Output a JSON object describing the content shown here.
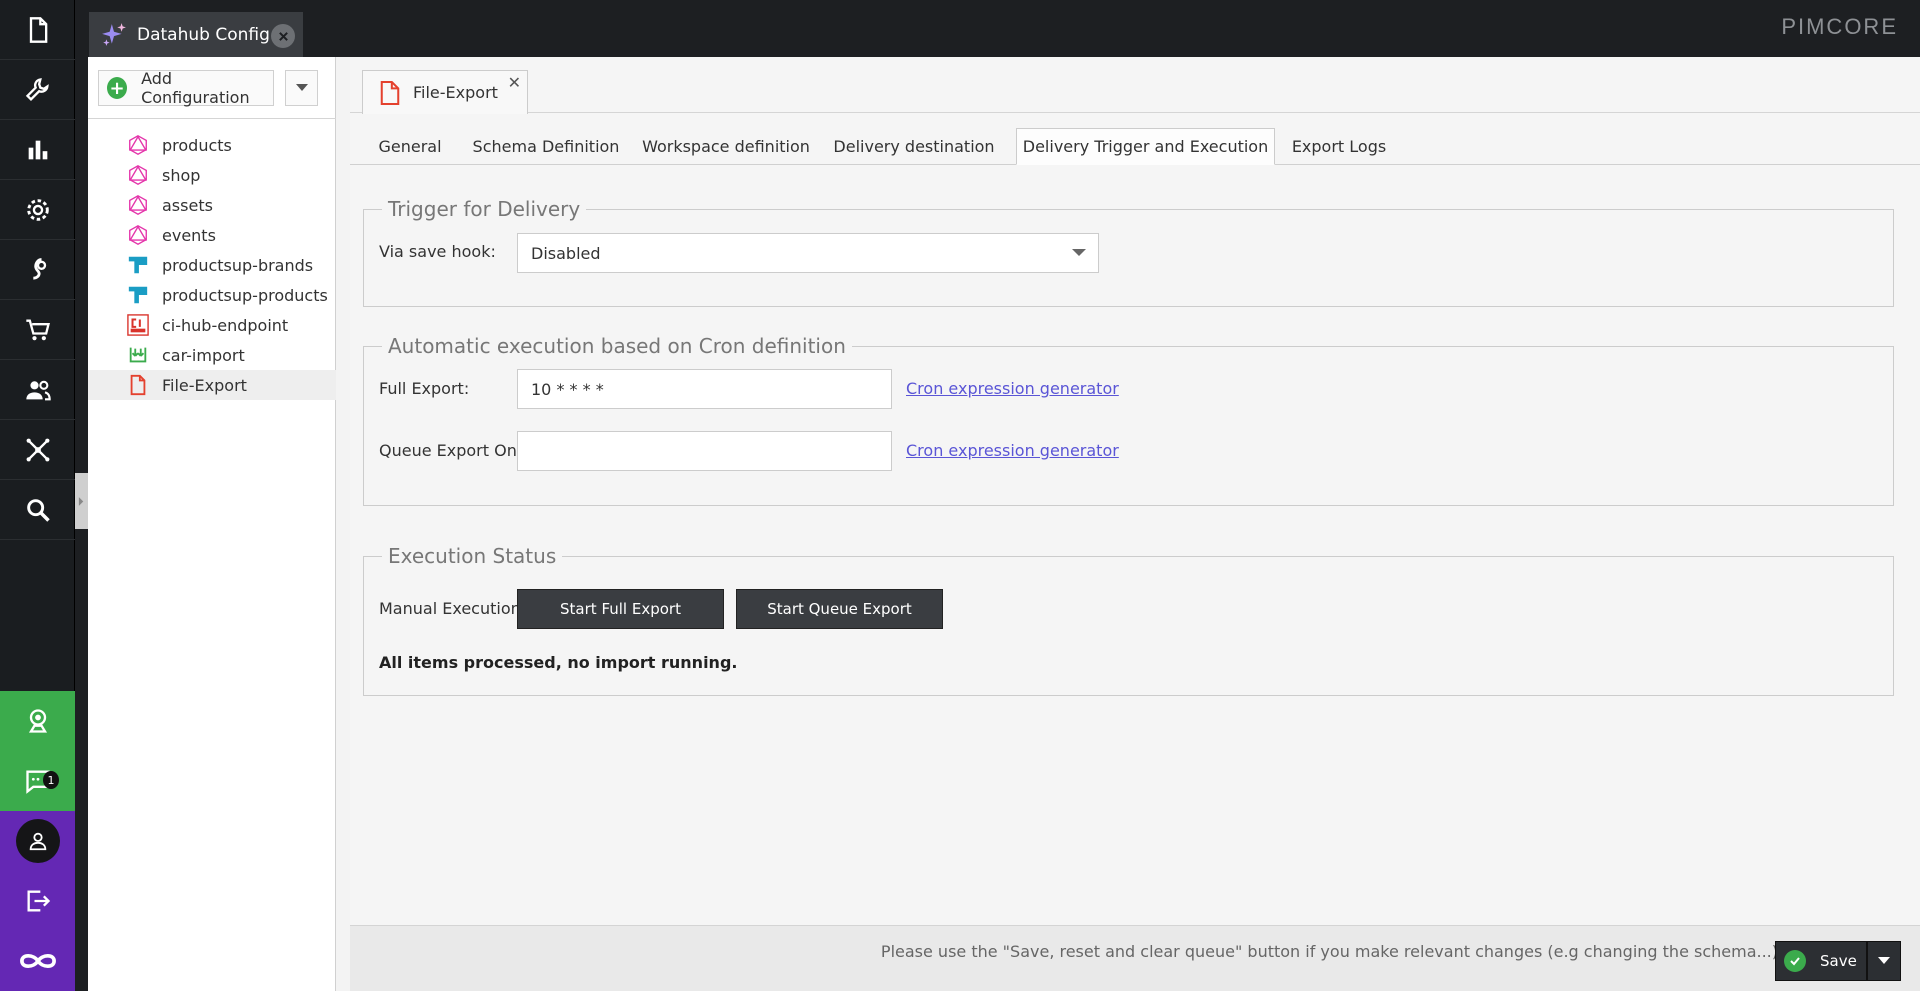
{
  "app": {
    "brand": "PIMCORE",
    "main_tab_title": "Datahub Config",
    "nav_icons": [
      "document-icon",
      "wrench-icon",
      "chart-icon",
      "gear-icon",
      "marketing-icon",
      "cart-icon",
      "users-icon",
      "datahub-icon",
      "search-icon"
    ],
    "notification_count": "1"
  },
  "tree": {
    "add_label": "Add Configuration",
    "items": [
      {
        "label": "products",
        "icon": "graphql-icon"
      },
      {
        "label": "shop",
        "icon": "graphql-icon"
      },
      {
        "label": "assets",
        "icon": "graphql-icon"
      },
      {
        "label": "events",
        "icon": "graphql-icon"
      },
      {
        "label": "productsup-brands",
        "icon": "productsup-icon"
      },
      {
        "label": "productsup-products",
        "icon": "productsup-icon"
      },
      {
        "label": "ci-hub-endpoint",
        "icon": "cihub-icon"
      },
      {
        "label": "car-import",
        "icon": "import-icon"
      },
      {
        "label": "File-Export",
        "icon": "file-icon"
      }
    ]
  },
  "editor": {
    "doc_tab": "File-Export",
    "tabs": [
      "General",
      "Schema Definition",
      "Workspace definition",
      "Delivery destination",
      "Delivery Trigger and Execution",
      "Export Logs"
    ],
    "active_tab": "Delivery Trigger and Execution",
    "trigger": {
      "legend": "Trigger for Delivery",
      "save_hook_label": "Via save hook:",
      "save_hook_value": "Disabled"
    },
    "cron": {
      "legend": "Automatic execution based on Cron definition",
      "full_label": "Full Export:",
      "full_value": "10 * * * *",
      "queue_label": "Queue Export Only:",
      "queue_value": "",
      "generator_link": "Cron expression generator"
    },
    "execution": {
      "legend": "Execution Status",
      "manual_label": "Manual Execution:",
      "start_full": "Start Full Export",
      "start_queue": "Start Queue Export",
      "status": "All items processed, no import running."
    },
    "footer": {
      "note": "Please use the \"Save, reset and clear queue\" button if you make relevant changes (e.g changing the schema...)",
      "save_label": "Save"
    }
  },
  "colors": {
    "green": "#3bab4c",
    "purple": "#6428b4",
    "link": "#5a55d6",
    "graphql_pink": "#e535ab",
    "productsup_teal": "#1a9dc4"
  }
}
